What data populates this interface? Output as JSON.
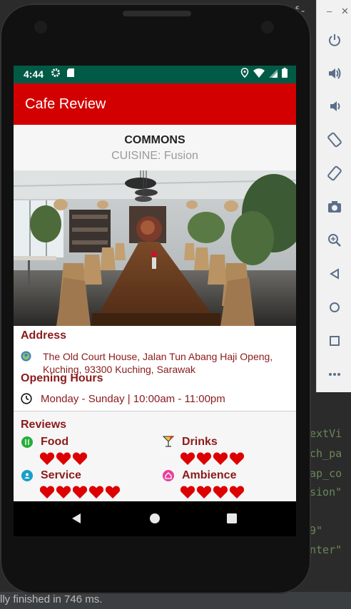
{
  "ide": {
    "code_lines": [
      "utf-",
      "extVi",
      "ch_pa",
      "ap_co",
      "sion\"",
      "9\"",
      "nter\""
    ],
    "status_text": "lly finished in 746 ms."
  },
  "emulator_toolbar": {
    "window_controls": [
      "–",
      "✕"
    ],
    "buttons": [
      "power-icon",
      "volume-up-icon",
      "volume-down-icon",
      "rotate-left-icon",
      "rotate-right-icon",
      "camera-icon",
      "zoom-icon",
      "back-icon",
      "home-icon",
      "overview-icon",
      "more-icon"
    ]
  },
  "status_bar": {
    "time": "4:44"
  },
  "app": {
    "title": "Cafe Review"
  },
  "cafe": {
    "name": "COMMONS",
    "cuisine": "CUISINE: Fusion"
  },
  "address": {
    "title": "Address",
    "line1": "The Old Court House, Jalan Tun Abang Haji Openg,",
    "line2": "Kuching, 93300 Kuching, Sarawak"
  },
  "hours": {
    "title": "Opening Hours",
    "text": "Monday - Sunday | 10:00am - 11:00pm"
  },
  "reviews": {
    "title": "Reviews",
    "categories": [
      {
        "label": "Food",
        "rating": 3,
        "icon": "fork-knife-icon",
        "color": "#27ae3a"
      },
      {
        "label": "Drinks",
        "rating": 4,
        "icon": "cocktail-icon",
        "color": "#e0a020"
      },
      {
        "label": "Service",
        "rating": 5,
        "icon": "service-icon",
        "color": "#18a0c8"
      },
      {
        "label": "Ambience",
        "rating": 4,
        "icon": "ambience-icon",
        "color": "#e8409a"
      }
    ],
    "heart_color": "#dd0000"
  },
  "colors": {
    "status_bar": "#005a46",
    "app_bar": "#d20000",
    "accent_text": "#8b1a1a"
  }
}
